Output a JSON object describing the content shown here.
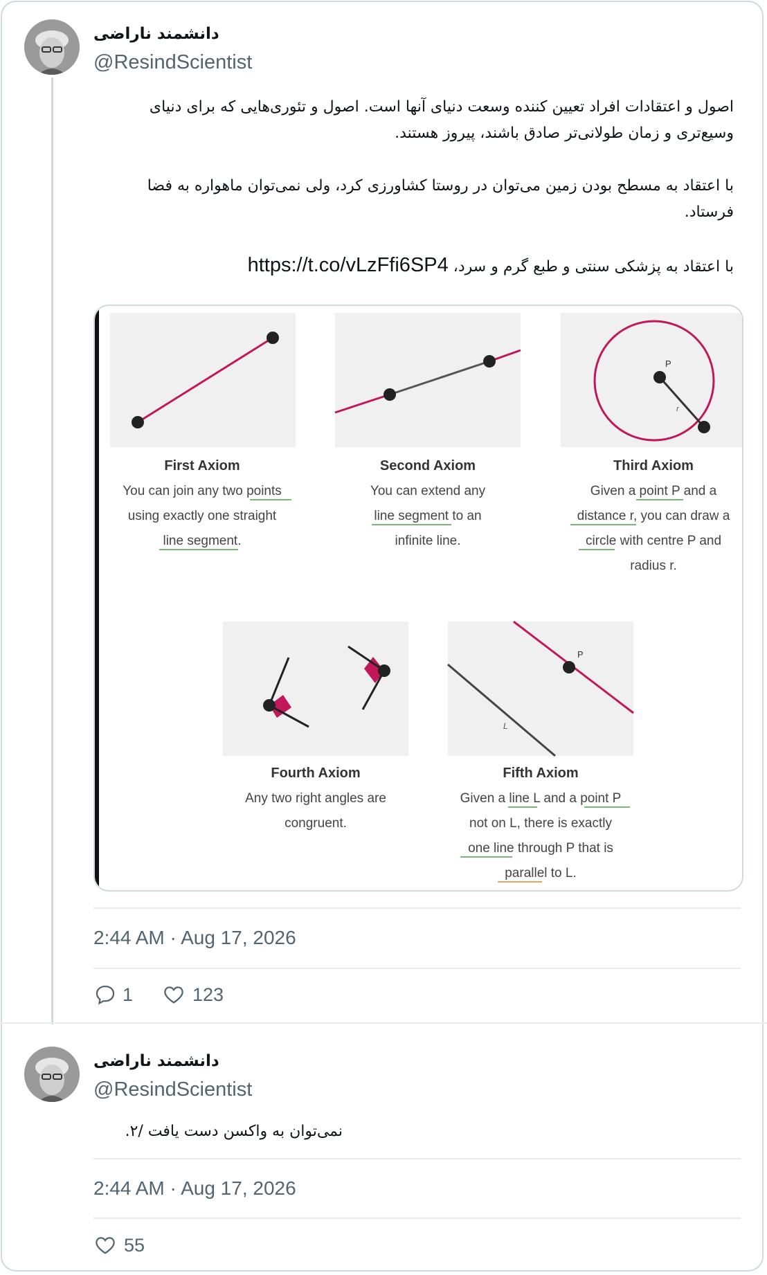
{
  "tweet1": {
    "author_name": "دانشمند ناراضی",
    "handle": "@ResindScientist",
    "paragraphs": [
      "اصول و اعتقادات افراد تعیین کننده وسعت دنیای آنها است. اصول و تئوری‌هایی که برای دنیای وسیع‌تری و زمان طولانی‌تر صادق باشند، پیروز هستند.",
      "با اعتقاد به مسطح بودن زمین می‌توان در روستا کشاورزی کرد، ولی نمی‌توان ماهواره به فضا فرستاد."
    ],
    "para3_text": "با اعتقاد به پزشکی سنتی و طبع گرم و سرد،",
    "para3_link": "https://t.co/vLzFfi6SP4",
    "timestamp": "2:44 AM · Aug 17, 2026",
    "replies": "1",
    "likes": "123"
  },
  "media": {
    "axioms": [
      {
        "title": "First Axiom",
        "lines": [
          "You can join any two points",
          "using exactly one straight",
          "line segment."
        ]
      },
      {
        "title": "Second Axiom",
        "lines": [
          "You can extend any",
          "line segment to an",
          "infinite line."
        ]
      },
      {
        "title": "Third Axiom",
        "lines": [
          "Given a point P and a",
          "distance r, you can draw a",
          "circle with centre P and",
          "radius r."
        ]
      },
      {
        "title": "Fourth Axiom",
        "lines": [
          "Any two right angles are",
          "congruent."
        ]
      },
      {
        "title": "Fifth Axiom",
        "lines": [
          "Given a line L and a point P",
          "not on L, there is exactly",
          "one line through P that is",
          "parallel to L."
        ]
      }
    ],
    "labels": {
      "p": "P",
      "r": "r",
      "l": "L"
    }
  },
  "tweet2": {
    "author_name": "دانشمند ناراضی",
    "handle": "@ResindScientist",
    "text": "نمی‌توان به واکسن دست یافت /۲.",
    "timestamp": "2:44 AM · Aug 17, 2026",
    "likes": "55"
  },
  "colors": {
    "accent": "#c0185a",
    "border": "#cfd9de",
    "muted": "#536471",
    "underline_green": "#7ab87a",
    "underline_orange": "#e5a65a"
  }
}
